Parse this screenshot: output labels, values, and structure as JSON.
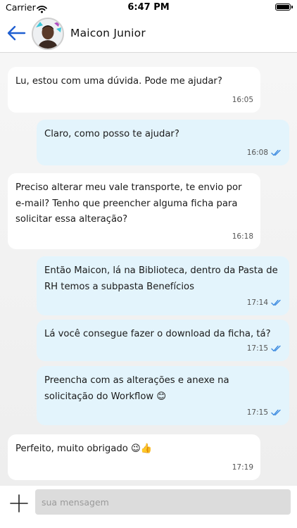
{
  "status_bar": {
    "carrier": "Carrier",
    "time": "6:47 PM"
  },
  "header": {
    "contact_name": "Maicon Junior"
  },
  "messages": [
    {
      "direction": "in",
      "text": "Lu, estou com uma dúvida. Pode me ajudar?",
      "time": "16:05"
    },
    {
      "direction": "out",
      "text": "Claro, como posso te ajudar?",
      "time": "16:08"
    },
    {
      "direction": "in",
      "text": "Preciso alterar meu vale transporte, te envio por e-mail? Tenho que preencher alguma ficha para solicitar essa alteração?",
      "time": "16:18"
    },
    {
      "direction": "out",
      "text": "Então Maicon, lá na Biblioteca, dentro da Pasta de RH temos a subpasta Benefícios",
      "time": "17:14"
    },
    {
      "direction": "out",
      "text": "Lá você consegue fazer o download da ficha, tá?",
      "time": "17:15"
    },
    {
      "direction": "out",
      "text": "Preencha com as alterações e anexe na solicitação do Workflow 😊",
      "time": "17:15"
    },
    {
      "direction": "in",
      "text": "Perfeito, muito obrigado 😉👍",
      "time": "17:19"
    }
  ],
  "composer": {
    "placeholder": "sua mensagem"
  },
  "colors": {
    "accent": "#1f5fd1",
    "outgoing_bubble": "#e3f4fc",
    "incoming_bubble": "#ffffff",
    "read_tick": "#3d8be0"
  },
  "icons": {
    "back": "arrow-left-icon",
    "add": "plus-icon",
    "read": "double-check-icon"
  }
}
